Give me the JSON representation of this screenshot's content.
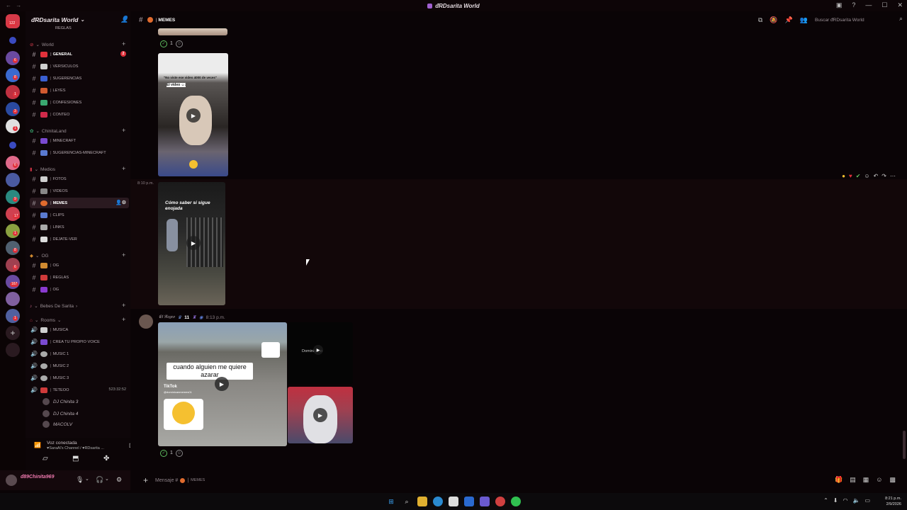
{
  "window": {
    "title": "ᵭRDsarita World",
    "controls": [
      "help",
      "minimize",
      "maximize",
      "close"
    ]
  },
  "rail": {
    "badges": [
      "122",
      "6",
      "8",
      "1",
      "3",
      "1",
      "6",
      "9",
      "17",
      "1",
      "8",
      "6",
      "167",
      "1"
    ]
  },
  "server": {
    "name": "ᵭRDsarita World"
  },
  "sidebar": {
    "top_partial": "REGLAS",
    "categories": [
      {
        "label": "World",
        "channels": [
          {
            "name": "GENERAL",
            "type": "text",
            "color": "#e0313b",
            "mention": "2",
            "active": false
          },
          {
            "name": "VERSICULOS",
            "type": "text",
            "color": "#cfcfcf"
          },
          {
            "name": "SUGERENCIAS",
            "type": "text",
            "color": "#3a5fd0"
          },
          {
            "name": "LEYES",
            "type": "text",
            "color": "#d05a30"
          },
          {
            "name": "CONFESIONES",
            "type": "text",
            "color": "#3aa870"
          },
          {
            "name": "CONTEO",
            "type": "text",
            "color": "#d02a4a"
          }
        ]
      },
      {
        "label": "ChinitaLand",
        "channels": [
          {
            "name": "MINECRAFT",
            "type": "text",
            "color": "#7a4ad0"
          },
          {
            "name": "SUGERENCIAS-MINECRAFT",
            "type": "text",
            "color": "#5a7ad0"
          }
        ]
      },
      {
        "label": "Medios",
        "channels": [
          {
            "name": "FOTOS",
            "type": "text",
            "color": "#cfcfcf"
          },
          {
            "name": "VIDEOS",
            "type": "text",
            "color": "#888"
          },
          {
            "name": "MEMES",
            "type": "text",
            "color": "#e06b2e",
            "active": true
          },
          {
            "name": "CLIPS",
            "type": "text",
            "color": "#5a7ad0"
          },
          {
            "name": "LINKS",
            "type": "text",
            "color": "#aaa"
          },
          {
            "name": "DEJATE-VER",
            "type": "text",
            "color": "#ddd"
          }
        ]
      },
      {
        "label": "OG",
        "channels": [
          {
            "name": "OG",
            "type": "text",
            "color": "#d08a30"
          },
          {
            "name": "REGLAS",
            "type": "text",
            "color": "#d03a3a"
          },
          {
            "name": "OG",
            "type": "text",
            "color": "#8a3ad0"
          }
        ]
      },
      {
        "label": "Bebes De Sarita",
        "channels": []
      },
      {
        "label": "Rooms",
        "channels": [
          {
            "name": "MUSICA",
            "type": "voice",
            "color": "#cfcfcf"
          },
          {
            "name": "CREA TU PROPIO VOICE",
            "type": "voice",
            "color": "#7a4ad0"
          },
          {
            "name": "MUSIC 1",
            "type": "voice",
            "color": "#aaa"
          },
          {
            "name": "MUSIC 2",
            "type": "voice",
            "color": "#aaa"
          },
          {
            "name": "MUSIC 3",
            "type": "voice",
            "color": "#aaa"
          },
          {
            "name": "TETEOO",
            "type": "voice",
            "color": "#d03a3a",
            "time": "523:32:52"
          }
        ]
      }
    ],
    "voice_users": [
      "DJ Chinita 3",
      "DJ Chinita 4",
      "MACOLV"
    ],
    "voice_status": {
      "label": "Voz conectada",
      "channel": "♥SaraAl's Channel / ♥RDsarita ..."
    },
    "user": {
      "name": "ᵭ89Chinita969"
    }
  },
  "channel": {
    "name": "MEMES",
    "search_placeholder": "Buscar ᵭRDsarita World"
  },
  "messages": {
    "reaction_count_1": "1",
    "video2_time": "8:10 p.m.",
    "video1_caption_top": "\"No viste ese video 4000 de veces\"",
    "video1_caption_2": "El video ☺:",
    "video2_caption": "Cómo saber si sigue enojada",
    "author": "𝔈𝔩 𝔑𝔢𝔤𝔯𝔬",
    "author_tag": "11",
    "author_time": "8:13 p.m.",
    "video3_caption": "cuando alguien me quiere azarar",
    "video3_tiktok": "TikTok",
    "video3_handle": "@dominicanmemes01",
    "video4_text": "Dominicano",
    "reaction_count_2": "1"
  },
  "composer": {
    "placeholder": "Mensaje #",
    "channel_label": "MEMES"
  },
  "taskbar": {
    "time": "8:21 p.m.",
    "date": "2/9/2026"
  },
  "colors": {
    "accent_red": "#e0313b",
    "background": "#0a0406",
    "sidebar": "#0e0609",
    "active_channel": "#2a1a20"
  }
}
